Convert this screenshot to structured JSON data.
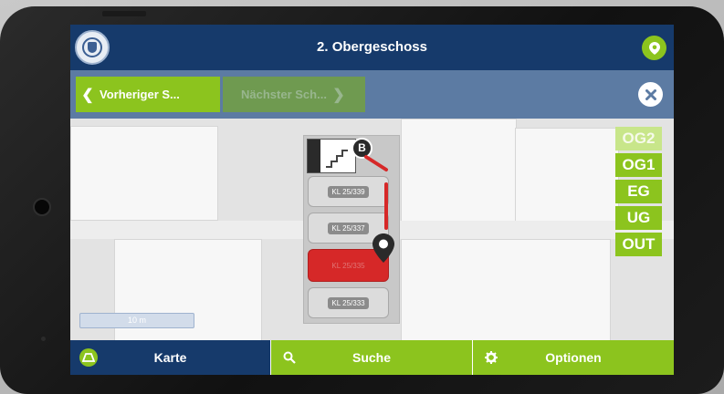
{
  "header": {
    "title": "2. Obergeschoss"
  },
  "nav": {
    "prev_label": "Vorheriger S...",
    "next_label": "Nächster Sch..."
  },
  "map": {
    "rooms": [
      "KL 25/339",
      "KL 25/337",
      "KL 25/335",
      "KL 25/333"
    ],
    "highlighted_room": "KL 25/335",
    "stair_badge": "B",
    "scale_label": "10 m",
    "floors": [
      "OG2",
      "OG1",
      "EG",
      "UG",
      "OUT"
    ],
    "active_floor": "OG2"
  },
  "tabs": [
    {
      "label": "Karte",
      "icon": "map-icon",
      "active": true
    },
    {
      "label": "Suche",
      "icon": "search-icon",
      "active": false
    },
    {
      "label": "Optionen",
      "icon": "gear-icon",
      "active": false
    }
  ],
  "colors": {
    "header": "#163a6b",
    "nav_bar": "#5c7ba3",
    "accent_green": "#8cc41e",
    "route_red": "#d62828"
  }
}
